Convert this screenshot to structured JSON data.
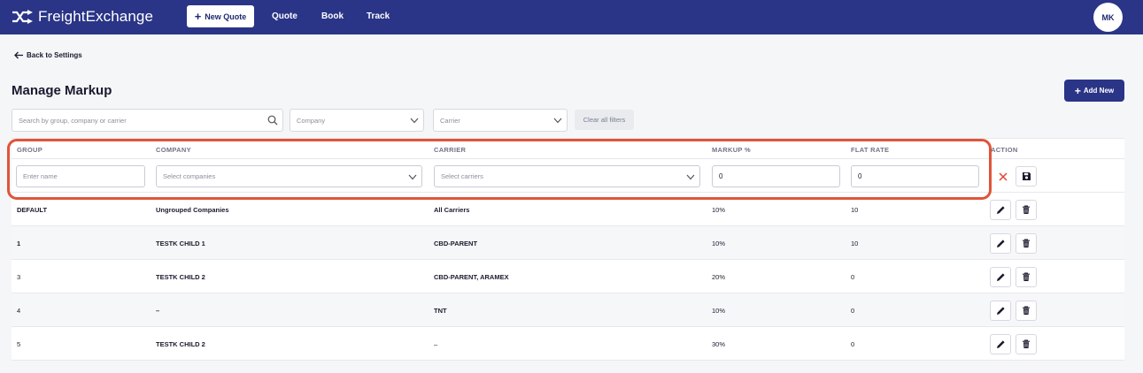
{
  "nav": {
    "logo_text": "FreightExchange",
    "new_quote_label": "New Quote",
    "links": [
      "Quote",
      "Book",
      "Track"
    ],
    "avatar_initials": "MK",
    "brand_color": "#2a3587"
  },
  "back_label": "Back to Settings",
  "page_title": "Manage Markup",
  "add_new_label": "Add New",
  "filters": {
    "search_placeholder": "Search by group, company or carrier",
    "company_placeholder": "Company",
    "carrier_placeholder": "Carrier",
    "clear_label": "Clear all filters"
  },
  "table": {
    "headers": [
      "GROUP",
      "COMPANY",
      "CARRIER",
      "MARKUP %",
      "FLAT RATE",
      "ACTION"
    ],
    "edit_row": {
      "group_placeholder": "Enter name",
      "company_placeholder": "Select companies",
      "carrier_placeholder": "Select carriers",
      "markup_value": "0",
      "flat_rate_value": "0"
    },
    "rows": [
      {
        "group": "DEFAULT",
        "company": "Ungrouped Companies",
        "carrier": "All Carriers",
        "markup": "10%",
        "flat_rate": "10"
      },
      {
        "group": "1",
        "company": "TESTK CHILD 1",
        "carrier": "CBD-PARENT",
        "markup": "10%",
        "flat_rate": "10"
      },
      {
        "group": "3",
        "company": "TESTK CHILD 2",
        "carrier": "CBD-PARENT, ARAMEX",
        "markup": "20%",
        "flat_rate": "0"
      },
      {
        "group": "4",
        "company": "–",
        "carrier": "TNT",
        "markup": "10%",
        "flat_rate": "0"
      },
      {
        "group": "5",
        "company": "TESTK CHILD 2",
        "carrier": "–",
        "markup": "30%",
        "flat_rate": "0"
      }
    ]
  },
  "accent_highlight_color": "#e0543a"
}
